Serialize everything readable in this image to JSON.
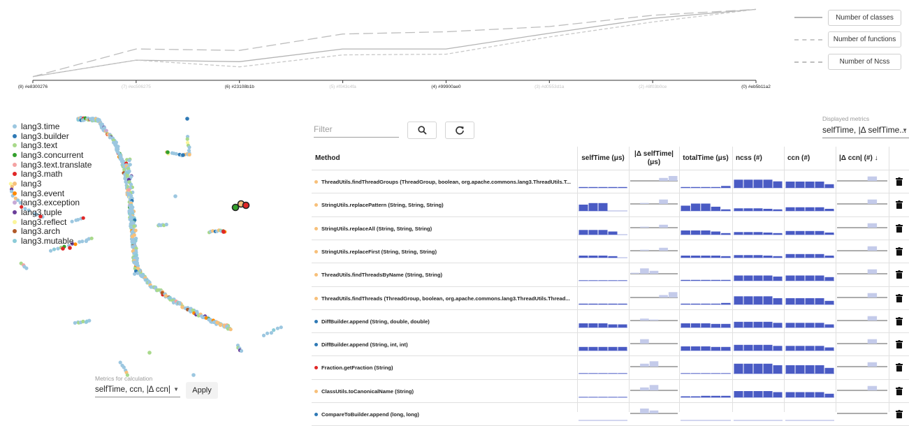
{
  "evolution": {
    "commits": [
      "(8) #e8300276",
      "(7) #ec506275",
      "(6) #23108b1b",
      "(5) #f043c4fa",
      "(4) #99900ae0",
      "(3) #d0553d1a",
      "(2) #8f03b0ce",
      "(0) #eb5b11a2"
    ],
    "highlighted_commits": [
      0,
      2,
      4,
      7
    ],
    "series": [
      {
        "name": "Number of classes",
        "style": "solid",
        "color": "#b4b4b4",
        "values": [
          0.05,
          0.27,
          0.25,
          0.42,
          0.42,
          0.63,
          0.83,
          0.95
        ]
      },
      {
        "name": "Number of functions",
        "style": "short-dash",
        "color": "#c8c8c8",
        "values": [
          0.05,
          0.27,
          0.18,
          0.34,
          0.35,
          0.58,
          0.78,
          0.95
        ]
      },
      {
        "name": "Number of Ncss",
        "style": "long-dash",
        "color": "#bdbdbd",
        "values": [
          0.05,
          0.42,
          0.4,
          0.62,
          0.65,
          0.72,
          0.87,
          0.95
        ]
      }
    ]
  },
  "packages": [
    {
      "name": "lang3.time",
      "color": "#9cc7e0"
    },
    {
      "name": "lang3.builder",
      "color": "#2e79b5"
    },
    {
      "name": "lang3.text",
      "color": "#a9d98b"
    },
    {
      "name": "lang3.concurrent",
      "color": "#33a02c"
    },
    {
      "name": "lang3.text.translate",
      "color": "#f4a3a3"
    },
    {
      "name": "lang3.math",
      "color": "#e02626"
    },
    {
      "name": "lang3",
      "color": "#f7c07a"
    },
    {
      "name": "lang3.event",
      "color": "#ff8a00"
    },
    {
      "name": "lang3.exception",
      "color": "#c7a9d6"
    },
    {
      "name": "lang3.tuple",
      "color": "#6a3d9a"
    },
    {
      "name": "lang3.reflect",
      "color": "#fbf59a"
    },
    {
      "name": "lang3.arch",
      "color": "#b15928"
    },
    {
      "name": "lang3.mutable",
      "color": "#8ccbd8"
    }
  ],
  "calc": {
    "label": "Metrics for calculation",
    "value": "selfTime, ccn, |Δ ccn|",
    "apply": "Apply"
  },
  "toolbar": {
    "filter_placeholder": "Filter"
  },
  "displayed": {
    "label": "Displayed metrics",
    "value": "selfTime, |Δ selfTime..."
  },
  "table": {
    "columns": [
      "Method",
      "selfTime (μs)",
      "|Δ selfTime| (μs)",
      "totalTime (μs)",
      "ncss (#)",
      "ccn (#)",
      "|Δ ccn| (#) ↓"
    ],
    "rows": [
      {
        "method": "ThreadUtils.findThreadGroups (ThreadGroup, boolean, org.apache.commons.lang3.ThreadUtils.T...",
        "color": "#f7c07a",
        "selfTime": [
          0.08,
          0.08,
          0.08,
          0.08,
          0.08
        ],
        "dSelf": [
          0,
          0,
          0,
          0.3,
          0.5
        ],
        "totalTime": [
          0.08,
          0.08,
          0.08,
          0.08,
          0.18
        ],
        "ncss": [
          0.78,
          0.78,
          0.78,
          0.78,
          0.62
        ],
        "ccn": [
          0.6,
          0.6,
          0.6,
          0.6,
          0.35
        ],
        "dCcn": [
          0,
          0,
          0,
          0.45,
          0
        ]
      },
      {
        "method": "StringUtils.replacePattern (String, String, String)",
        "color": "#f7c07a",
        "selfTime": [
          0.6,
          0.75,
          0.75,
          0,
          0
        ],
        "dSelf": [
          0,
          0.1,
          0,
          0.45,
          0
        ],
        "totalTime": [
          0.5,
          0.7,
          0.7,
          0.4,
          0.15
        ],
        "ncss": [
          0.25,
          0.25,
          0.25,
          0.2,
          0.15
        ],
        "ccn": [
          0.35,
          0.35,
          0.35,
          0.35,
          0.2
        ],
        "dCcn": [
          0,
          0,
          0,
          0.45,
          0
        ]
      },
      {
        "method": "StringUtils.replaceAll (String, String, String)",
        "color": "#f7c07a",
        "selfTime": [
          0.45,
          0.45,
          0.45,
          0.3,
          0
        ],
        "dSelf": [
          0,
          0.1,
          0,
          0.3,
          0
        ],
        "totalTime": [
          0.4,
          0.4,
          0.4,
          0.3,
          0.15
        ],
        "ncss": [
          0.25,
          0.25,
          0.25,
          0.2,
          0.15
        ],
        "ccn": [
          0.35,
          0.35,
          0.35,
          0.35,
          0.2
        ],
        "dCcn": [
          0,
          0,
          0,
          0.45,
          0
        ]
      },
      {
        "method": "StringUtils.replaceFirst (String, String, String)",
        "color": "#f7c07a",
        "selfTime": [
          0.2,
          0.2,
          0.2,
          0.15,
          0
        ],
        "dSelf": [
          0,
          0.1,
          0,
          0.3,
          0
        ],
        "totalTime": [
          0.2,
          0.2,
          0.2,
          0.2,
          0.15
        ],
        "ncss": [
          0.25,
          0.25,
          0.25,
          0.2,
          0.15
        ],
        "ccn": [
          0.35,
          0.35,
          0.35,
          0.35,
          0.2
        ],
        "dCcn": [
          0,
          0,
          0,
          0.45,
          0
        ]
      },
      {
        "method": "ThreadUtils.findThreadsByName (String, String)",
        "color": "#f7c07a",
        "selfTime": [
          0.05,
          0.05,
          0.05,
          0.05,
          0.05
        ],
        "dSelf": [
          0.1,
          0.55,
          0.3,
          0,
          0
        ],
        "totalTime": [
          0.08,
          0.08,
          0.08,
          0.08,
          0.08
        ],
        "ncss": [
          0.5,
          0.5,
          0.5,
          0.5,
          0.4
        ],
        "ccn": [
          0.5,
          0.5,
          0.5,
          0.5,
          0.35
        ],
        "dCcn": [
          0,
          0,
          0,
          0.45,
          0
        ]
      },
      {
        "method": "ThreadUtils.findThreads (ThreadGroup, boolean, org.apache.commons.lang3.ThreadUtils.Thread...",
        "color": "#f7c07a",
        "selfTime": [
          0.08,
          0.08,
          0.08,
          0.08,
          0.08
        ],
        "dSelf": [
          0,
          0,
          0,
          0.25,
          0.55
        ],
        "totalTime": [
          0.08,
          0.08,
          0.08,
          0.08,
          0.15
        ],
        "ncss": [
          0.78,
          0.78,
          0.78,
          0.78,
          0.6
        ],
        "ccn": [
          0.6,
          0.6,
          0.6,
          0.6,
          0.35
        ],
        "dCcn": [
          0,
          0,
          0,
          0.45,
          0
        ]
      },
      {
        "method": "DiffBuilder.append (String, double, double)",
        "color": "#2e79b5",
        "selfTime": [
          0.4,
          0.4,
          0.4,
          0.3,
          0.3
        ],
        "dSelf": [
          0,
          0.2,
          0.1,
          0,
          0
        ],
        "totalTime": [
          0.4,
          0.4,
          0.4,
          0.35,
          0.35
        ],
        "ncss": [
          0.55,
          0.55,
          0.55,
          0.55,
          0.45
        ],
        "ccn": [
          0.45,
          0.45,
          0.45,
          0.45,
          0.3
        ],
        "dCcn": [
          0,
          0,
          0,
          0.45,
          0
        ]
      },
      {
        "method": "DiffBuilder.append (String, int, int)",
        "color": "#2e79b5",
        "selfTime": [
          0.35,
          0.35,
          0.35,
          0.35,
          0.35
        ],
        "dSelf": [
          0,
          0.45,
          0,
          0,
          0
        ],
        "totalTime": [
          0.4,
          0.4,
          0.4,
          0.35,
          0.35
        ],
        "ncss": [
          0.55,
          0.55,
          0.55,
          0.55,
          0.45
        ],
        "ccn": [
          0.45,
          0.45,
          0.45,
          0.45,
          0.3
        ],
        "dCcn": [
          0,
          0,
          0,
          0.45,
          0
        ]
      },
      {
        "method": "Fraction.getFraction (String)",
        "color": "#e02626",
        "selfTime": [
          0.05,
          0.05,
          0.05,
          0.05,
          0.05
        ],
        "dSelf": [
          0,
          0.3,
          0.55,
          0,
          0
        ],
        "totalTime": [
          0.05,
          0.05,
          0.05,
          0.05,
          0.05
        ],
        "ncss": [
          0.95,
          0.95,
          0.95,
          0.95,
          0.8
        ],
        "ccn": [
          0.8,
          0.8,
          0.8,
          0.8,
          0.55
        ],
        "dCcn": [
          0,
          0,
          0,
          0.45,
          0
        ]
      },
      {
        "method": "ClassUtils.toCanonicalName (String)",
        "color": "#f7c07a",
        "selfTime": [
          0.05,
          0.05,
          0.05,
          0.05,
          0.05
        ],
        "dSelf": [
          0,
          0.3,
          0.55,
          0,
          0
        ],
        "totalTime": [
          0.1,
          0.1,
          0.15,
          0.15,
          0.15
        ],
        "ncss": [
          0.6,
          0.6,
          0.6,
          0.6,
          0.5
        ],
        "ccn": [
          0.5,
          0.5,
          0.5,
          0.5,
          0.35
        ],
        "dCcn": [
          0,
          0,
          0,
          0.45,
          0
        ]
      },
      {
        "method": "CompareToBuilder.append (long, long)",
        "color": "#2e79b5",
        "selfTime": [
          0,
          0,
          0,
          0,
          0
        ],
        "dSelf": [
          0,
          0.5,
          0.3,
          0,
          0
        ],
        "totalTime": [
          0,
          0,
          0,
          0,
          0
        ],
        "ncss": [
          0,
          0,
          0,
          0,
          0
        ],
        "ccn": [
          0,
          0,
          0,
          0,
          0
        ],
        "dCcn": [
          0,
          0,
          0,
          0,
          0
        ]
      }
    ]
  },
  "colors": {
    "bar": "#4a5bc4",
    "delta_bar": "#c4cbea"
  }
}
